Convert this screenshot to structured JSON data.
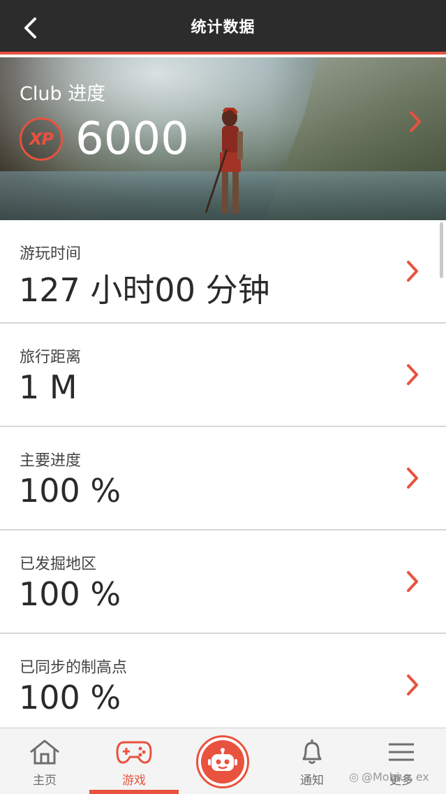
{
  "header": {
    "title": "统计数据"
  },
  "hero": {
    "club_label": "Club 进度",
    "xp_badge": "XP",
    "xp_value": "6000"
  },
  "stats": [
    {
      "label": "游玩时间",
      "value": "127 小时00 分钟"
    },
    {
      "label": "旅行距离",
      "value": "1 M"
    },
    {
      "label": "主要进度",
      "value": "100 %"
    },
    {
      "label": "已发掘地区",
      "value": "100 %"
    },
    {
      "label": "已同步的制高点",
      "value": "100 %"
    }
  ],
  "nav": {
    "home": "主页",
    "games": "游戏",
    "notifications": "通知",
    "more": "更多",
    "active": "games"
  },
  "watermark": "@Mobius ex",
  "colors": {
    "accent": "#e9523e",
    "header_bg": "#2c2c2c"
  }
}
